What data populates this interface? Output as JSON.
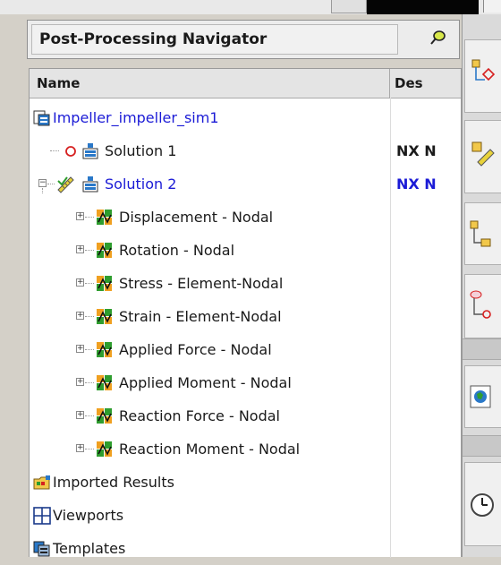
{
  "navigator": {
    "title": "Post-Processing Navigator",
    "pin_icon": "pin-icon"
  },
  "columns": {
    "name": "Name",
    "description": "Des"
  },
  "tree": {
    "root": {
      "label": "Impeller_impeller_sim1",
      "icon": "sim-file-icon"
    },
    "solution1": {
      "label": "Solution 1",
      "desc": "NX N",
      "icon": "solver-icon",
      "status_icon": "inactive-circle-icon"
    },
    "solution2": {
      "label": "Solution 2",
      "desc": "NX N",
      "icon": "solver-icon",
      "status_icon": "active-ruler-icon"
    },
    "results": [
      {
        "label": "Displacement - Nodal"
      },
      {
        "label": "Rotation - Nodal"
      },
      {
        "label": "Stress - Element-Nodal"
      },
      {
        "label": "Strain - Element-Nodal"
      },
      {
        "label": "Applied Force - Nodal"
      },
      {
        "label": "Applied Moment - Nodal"
      },
      {
        "label": "Reaction Force - Nodal"
      },
      {
        "label": "Reaction Moment - Nodal"
      }
    ],
    "imported": {
      "label": "Imported Results",
      "icon": "folder-results-icon"
    },
    "viewports": {
      "label": "Viewports",
      "icon": "viewports-grid-icon"
    },
    "templates": {
      "label": "Templates",
      "icon": "templates-icon"
    }
  },
  "colors": {
    "active_text": "#1b1bd6",
    "result_icon_green": "#2e9d2e",
    "result_icon_orange": "#f0a020"
  }
}
